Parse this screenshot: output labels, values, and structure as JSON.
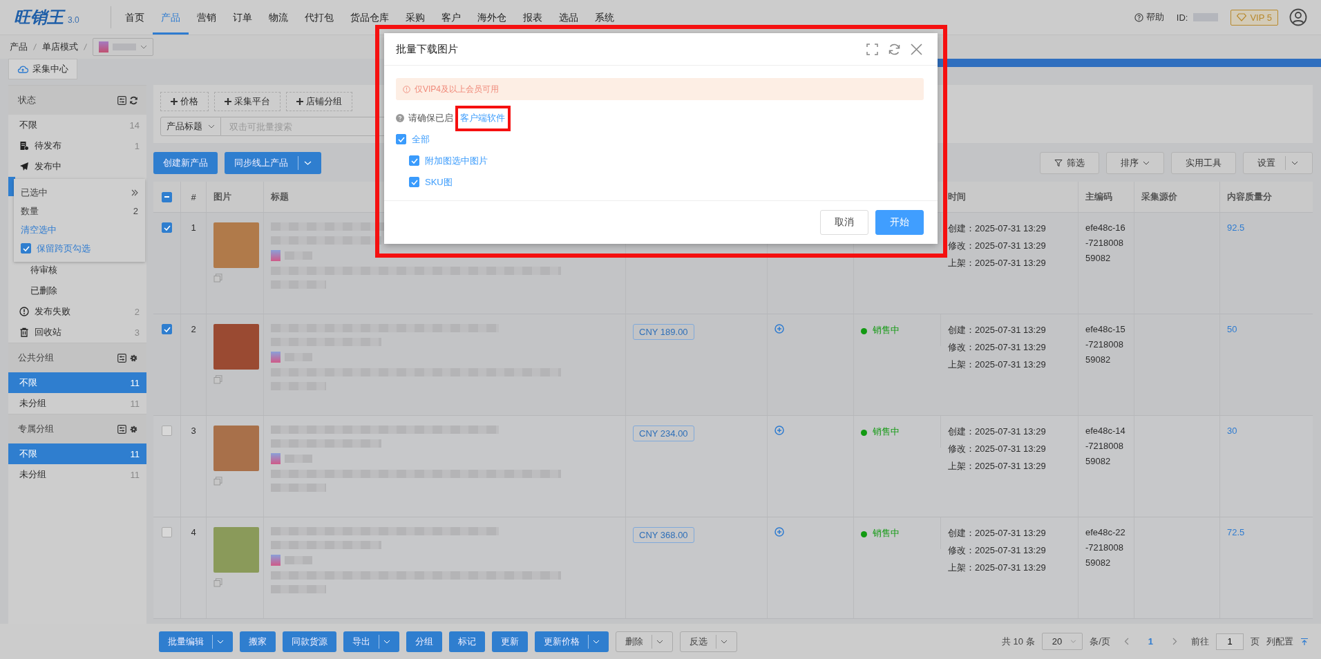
{
  "top_nav": {
    "logo": "旺销王",
    "version": "3.0",
    "items": [
      {
        "label": "首页",
        "selected": false
      },
      {
        "label": "产品",
        "selected": true
      },
      {
        "label": "营销",
        "selected": false
      },
      {
        "label": "订单",
        "selected": false
      },
      {
        "label": "物流",
        "selected": false
      },
      {
        "label": "代打包",
        "selected": false
      },
      {
        "label": "货品仓库",
        "selected": false
      },
      {
        "label": "采购",
        "selected": false
      },
      {
        "label": "客户",
        "selected": false
      },
      {
        "label": "海外仓",
        "selected": false
      },
      {
        "label": "报表",
        "selected": false
      },
      {
        "label": "选品",
        "selected": false
      },
      {
        "label": "系统",
        "selected": false
      }
    ],
    "help": "帮助",
    "id_label": "ID:",
    "vip": "VIP 5"
  },
  "breadcrumb": [
    "产品",
    "单店模式"
  ],
  "page_tab": "采集中心",
  "sidebar": {
    "sections": [
      {
        "title": "状态",
        "kind": "refresh",
        "items": [
          {
            "label": "不限",
            "count": "14",
            "kind": "plain",
            "selected": false
          },
          {
            "label": "待发布",
            "count": "1",
            "kind": "draft",
            "selected": false
          },
          {
            "label": "发布中",
            "kind": "sending",
            "selected": false
          },
          {
            "label": "待审核",
            "kind": "sub",
            "selected": false
          },
          {
            "label": "已删除",
            "kind": "sub",
            "selected": false
          },
          {
            "label": "发布失败",
            "count": "2",
            "kind": "failed",
            "selected": false
          },
          {
            "label": "回收站",
            "count": "3",
            "kind": "trash",
            "selected": false
          }
        ]
      },
      {
        "title": "公共分组",
        "kind": "settings",
        "items": [
          {
            "label": "不限",
            "count": "11",
            "kind": "plain",
            "selected": true
          },
          {
            "label": "未分组",
            "count": "11",
            "kind": "plain",
            "selected": false
          }
        ]
      },
      {
        "title": "专属分组",
        "kind": "settings",
        "items": [
          {
            "label": "不限",
            "count": "11",
            "kind": "plain",
            "selected": true
          },
          {
            "label": "未分组",
            "count": "11",
            "kind": "plain",
            "selected": false
          }
        ]
      }
    ]
  },
  "selection_popup": {
    "title": "已选中",
    "count_label": "数量",
    "count": "2",
    "clear": "清空选中",
    "keep": {
      "label": "保留跨页勾选",
      "checked": true
    }
  },
  "filters": {
    "chips": [
      "价格",
      "采集平台",
      "店铺分组"
    ],
    "search_field": "产品标题",
    "placeholder": "双击可批量搜索"
  },
  "actions": {
    "left": [
      {
        "label": "创建新产品",
        "split": false
      },
      {
        "label": "同步线上产品",
        "split": true
      }
    ],
    "right": [
      {
        "label": "筛选",
        "kind": "filter"
      },
      {
        "label": "排序",
        "kind": "dropdown"
      },
      {
        "label": "实用工具",
        "kind": "plain"
      },
      {
        "label": "设置",
        "kind": "split"
      }
    ]
  },
  "table": {
    "select_all_partial": true,
    "columns": {
      "index": "#",
      "image": "图片",
      "title": "标题",
      "time": "时间",
      "code": "主编码",
      "source_price": "采集源价",
      "score": "内容质量分"
    },
    "rows": [
      {
        "selected": true,
        "index": "1",
        "times": [
          "创建：2025-07-31 13:29",
          "修改：2025-07-31 13:29",
          "上架：2025-07-31 13:29"
        ],
        "code_lines": [
          "efe48c-16",
          "-7218008",
          "59082"
        ],
        "score": "92.5"
      },
      {
        "selected": true,
        "index": "2",
        "price": "CNY 189.00",
        "status": "销售中",
        "times": [
          "创建：2025-07-31 13:29",
          "修改：2025-07-31 13:29",
          "上架：2025-07-31 13:29"
        ],
        "code_lines": [
          "efe48c-15",
          "-7218008",
          "59082"
        ],
        "score": "50"
      },
      {
        "selected": false,
        "index": "3",
        "price": "CNY 234.00",
        "status": "销售中",
        "times": [
          "创建：2025-07-31 13:29",
          "修改：2025-07-31 13:29",
          "上架：2025-07-31 13:29"
        ],
        "code_lines": [
          "efe48c-14",
          "-7218008",
          "59082"
        ],
        "score": "30"
      },
      {
        "selected": false,
        "index": "4",
        "price": "CNY 368.00",
        "status": "销售中",
        "times": [
          "创建：2025-07-31 13:29",
          "修改：2025-07-31 13:29",
          "上架：2025-07-31 13:29"
        ],
        "code_lines": [
          "efe48c-22",
          "-7218008",
          "59082"
        ],
        "score": "72.5"
      }
    ]
  },
  "bottom_bar": {
    "buttons": [
      {
        "label": "批量编辑",
        "kind": "primary",
        "split": true
      },
      {
        "label": "搬家",
        "kind": "primary",
        "split": false
      },
      {
        "label": "同款货源",
        "kind": "primary",
        "split": false
      },
      {
        "label": "导出",
        "kind": "primary",
        "split": true
      },
      {
        "label": "分组",
        "kind": "primary",
        "split": false
      },
      {
        "label": "标记",
        "kind": "primary",
        "split": false
      },
      {
        "label": "更新",
        "kind": "primary",
        "split": false
      },
      {
        "label": "更新价格",
        "kind": "primary",
        "split": true
      },
      {
        "label": "删除",
        "kind": "default",
        "split": true
      },
      {
        "label": "反选",
        "kind": "default",
        "split": true
      }
    ],
    "total": "共 10 条",
    "page_size": "20",
    "per_page": "条/页",
    "pages": [
      {
        "label": "1",
        "selected": true
      }
    ],
    "goto": "前往",
    "goto_value": "1",
    "page_suffix": "页",
    "columns_link": "列配置"
  },
  "modal": {
    "title": "批量下载图片",
    "alert": "仅VIP4及以上会员可用",
    "notice": "请确保已启",
    "notice_link": "客户端软件",
    "option": {
      "label": "全部",
      "checked": true,
      "children": [
        {
          "label": "附加图选中图片",
          "checked": true
        },
        {
          "label": "SKU图",
          "checked": true
        }
      ]
    },
    "buttons": [
      {
        "label": "取消",
        "kind": "default"
      },
      {
        "label": "开始",
        "kind": "primary"
      }
    ]
  }
}
